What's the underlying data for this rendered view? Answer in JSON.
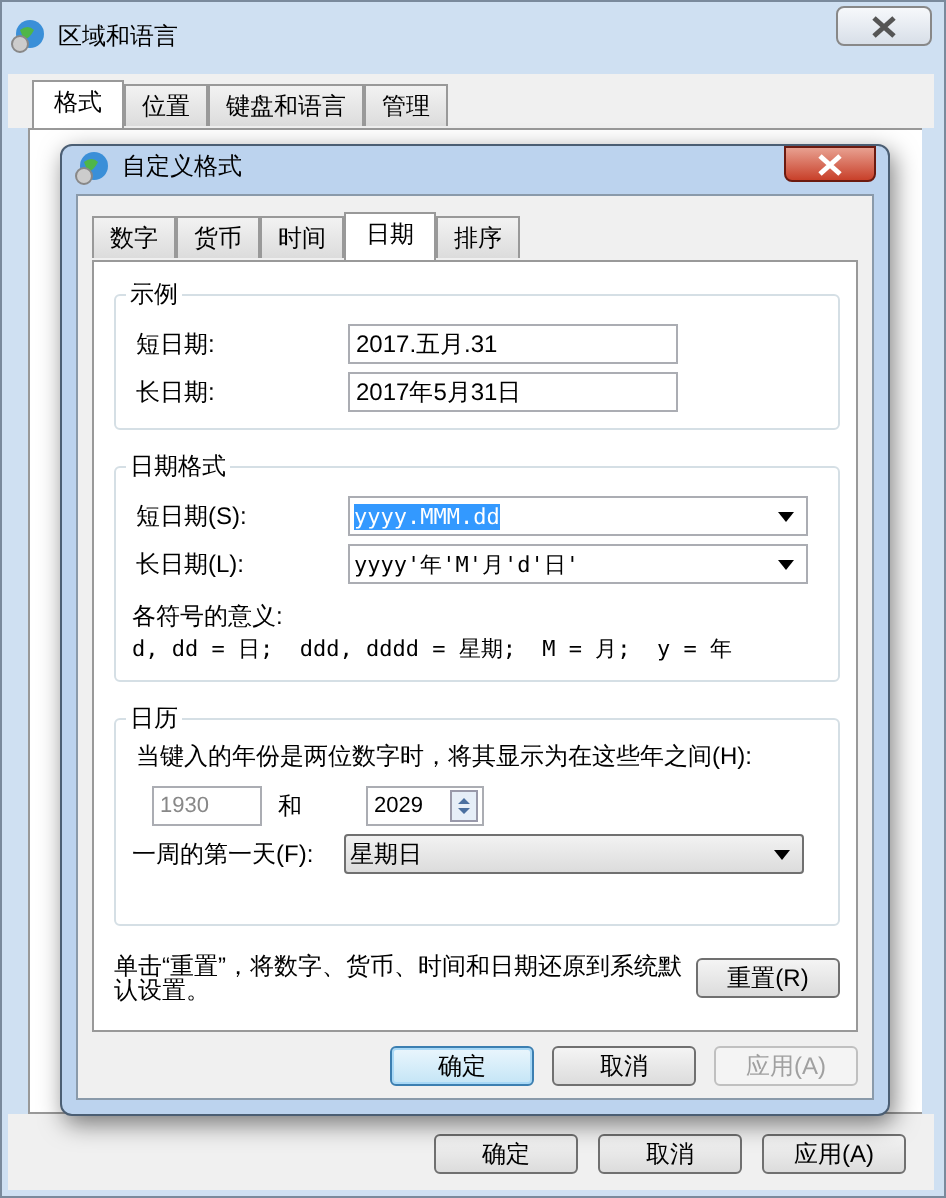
{
  "outer_window": {
    "title": "区域和语言",
    "tabs": [
      {
        "label": "格式",
        "selected": true
      },
      {
        "label": "位置",
        "selected": false
      },
      {
        "label": "键盘和语言",
        "selected": false
      },
      {
        "label": "管理",
        "selected": false
      }
    ],
    "buttons": [
      {
        "label": "确定",
        "disabled": false,
        "default": false
      },
      {
        "label": "取消",
        "disabled": false,
        "default": false
      },
      {
        "label": "应用(A)",
        "disabled": false,
        "default": false
      }
    ]
  },
  "dialog": {
    "title": "自定义格式",
    "tabs": [
      {
        "label": "数字",
        "selected": false
      },
      {
        "label": "货币",
        "selected": false
      },
      {
        "label": "时间",
        "selected": false
      },
      {
        "label": "日期",
        "selected": true
      },
      {
        "label": "排序",
        "selected": false
      }
    ],
    "sample": {
      "title": "示例",
      "fields": [
        {
          "label": "短日期:",
          "value": "2017.五月.31"
        },
        {
          "label": "长日期:",
          "value": "2017年5月31日"
        }
      ]
    },
    "date_formats": {
      "title": "日期格式",
      "fields": [
        {
          "label": "短日期(S):",
          "value": "yyyy.MMM.dd",
          "highlighted": true
        },
        {
          "label": "长日期(L):",
          "value": "yyyy'年'M'月'd'日'",
          "highlighted": false
        }
      ],
      "legend_title": "各符号的意义:",
      "legend": "d, dd = 日;  ddd, dddd = 星期;  M = 月;  y = 年"
    },
    "calendar": {
      "title": "日历",
      "note": "当键入的年份是两位数字时，将其显示为在这些年之间(H):",
      "year_from": {
        "value": "1930",
        "disabled": true
      },
      "and_label": "和",
      "year_to": {
        "value": "2029",
        "disabled": false
      },
      "first_day_label": "一周的第一天(F):",
      "first_day": "星期日"
    },
    "reset_note": "单击“重置”，将数字、货币、时间和日期还原到系统默认设置。",
    "reset_button": "重置(R)",
    "buttons": [
      {
        "label": "确定",
        "disabled": false,
        "default": true
      },
      {
        "label": "取消",
        "disabled": false,
        "default": false
      },
      {
        "label": "应用(A)",
        "disabled": true,
        "default": false
      }
    ]
  }
}
